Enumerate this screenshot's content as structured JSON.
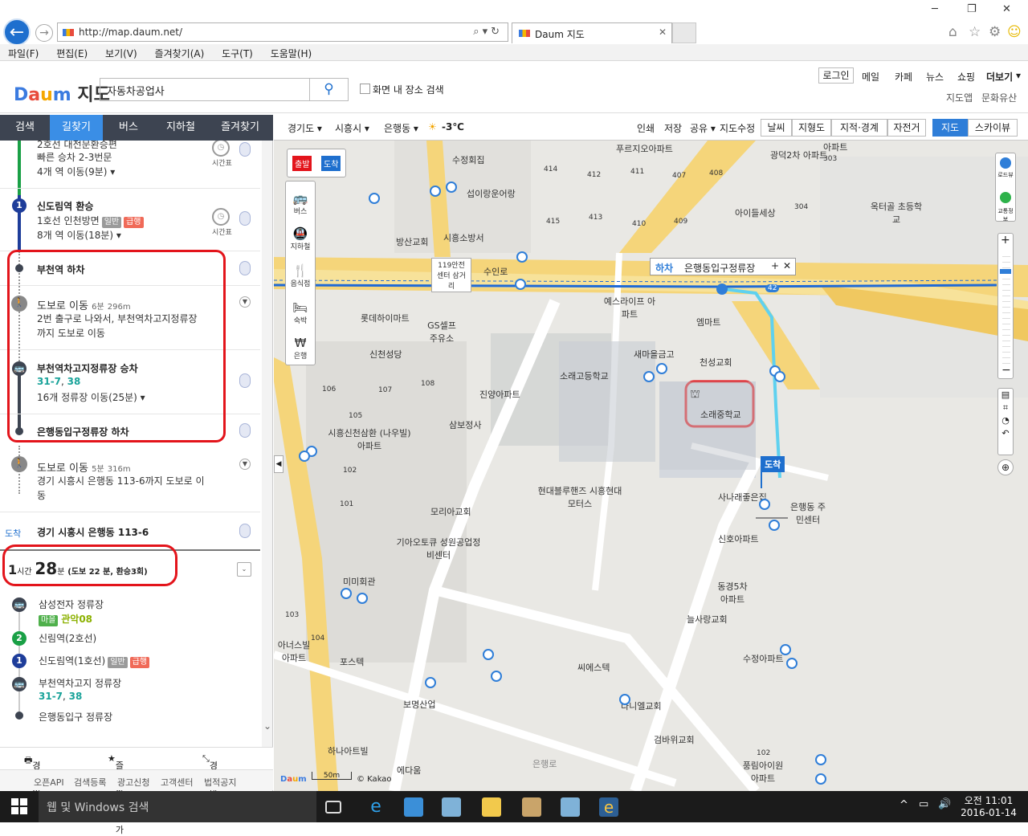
{
  "browser": {
    "url": "http://map.daum.net/",
    "tab_title": "Daum 지도",
    "menu": [
      "파일(F)",
      "편집(E)",
      "보기(V)",
      "즐겨찾기(A)",
      "도구(T)",
      "도움말(H)"
    ]
  },
  "header": {
    "logo": "Daum 지도",
    "logo_text": "지도",
    "search_value": "자동차공업사",
    "checkbox_label": "화면 내 장소 검색",
    "login": "로그인",
    "top_links": [
      "메일",
      "카페",
      "뉴스",
      "쇼핑",
      "더보기"
    ],
    "sub_links": [
      "지도앱",
      "문화유산"
    ]
  },
  "left_tabs": [
    "검색",
    "길찾기",
    "버스",
    "지하철",
    "즐겨찾기"
  ],
  "route": {
    "step0_sub1": "2호선 대전문환승편",
    "step0_sub2": "빠른 승차 2-3번문",
    "step0_sub3": "4개 역 이동(9분) ▾",
    "timetable": "시간표",
    "step1_title": "신도림역 환승",
    "step1_line": "1호선 인천방면",
    "tag_normal": "일반",
    "tag_express": "급행",
    "step1_move": "8개 역 이동(18분) ▾",
    "step2_title": "부천역 하차",
    "walk1_title": "도보로 이동",
    "walk1_time": "6분",
    "walk1_dist": "296m",
    "walk1_desc1": "2번 출구로 나와서, 부천역차고지정류장",
    "walk1_desc2": "까지 도보로 이동",
    "step3_title": "부천역차고지정류장 승차",
    "step3_bus1": "31-7",
    "step3_bus2": "38",
    "step3_move": "16개 정류장 이동(25분) ▾",
    "step4_title": "은행동입구정류장 하차",
    "walk2_title": "도보로 이동",
    "walk2_time": "5분",
    "walk2_dist": "316m",
    "walk2_desc1": "경기 시흥시 은행동 113-6까지 도보로 이",
    "walk2_desc2": "동",
    "arrive_tag": "도착",
    "arrive_addr": "경기 시흥시 은행동 113-6"
  },
  "summary": {
    "h": "1",
    "h_unit": "시간",
    "m": "28",
    "m_unit": "분",
    "detail": "(도보 22 분, 환승3회)"
  },
  "alt_route": {
    "s1": "삼성전자 정류장",
    "s1_tag": "마을",
    "s1_bus": "관악08",
    "s2": "신림역(2호선)",
    "s3": "신도림역(1호선)",
    "s4": "부천역차고지 정류장",
    "s4_bus1": "31-7",
    "s4_bus2": "38",
    "s5": "은행동입구 정류장"
  },
  "footer": {
    "print": "경로인쇄",
    "fav": "즐겨찾기 추가",
    "view": "경로 한눈에",
    "links": [
      "오픈API",
      "검색등록",
      "광고신청",
      "고객센터",
      "법적공지"
    ]
  },
  "map_toolbar": {
    "crumbs": [
      "경기도 ▾",
      "시흥시 ▾",
      "은행동 ▾"
    ],
    "weather": "-3℃",
    "actions": [
      "인쇄",
      "저장",
      "공유 ▾",
      "지도수정"
    ],
    "layers": [
      "날씨",
      "지형도",
      "지적·경계",
      "자전거"
    ],
    "views": [
      "지도",
      "스카이뷰"
    ]
  },
  "map_tools": {
    "start": "출발",
    "end": "도착",
    "items": [
      "버스",
      "지하철",
      "음식점",
      "숙박",
      "은행"
    ],
    "roadview": "로드뷰",
    "traffic": "교통정보"
  },
  "map_popup": {
    "tag": "하차",
    "name": "은행동입구정류장"
  },
  "map_labels": {
    "school": "소래중학교",
    "arrive": "도착",
    "scale": "50m",
    "kakao": "© Kakao",
    "l01": "푸르지오아파트",
    "l02": "광덕2차 아파트",
    "l03": "아파트",
    "l04": "수정회집",
    "l05": "섭이랑운어랑",
    "l06": "옥터골 초등학교",
    "l07": "아이들세상",
    "l08": "방산교회",
    "l09": "시흥소방서",
    "l10": "119안전센터 삼거리",
    "l11": "수인로",
    "l12": "예스라이프 아파트",
    "l13": "롯데하이마트",
    "l14": "GS셀프 주유소",
    "l15": "엠마트",
    "l16": "새마을금고",
    "l17": "천성교회",
    "l18": "신천성당",
    "l19": "소래고등학교",
    "l20": "진양아파트",
    "l21": "삼보정사",
    "l22": "시흥신천삼환 (나우빌)아파트",
    "l23": "현대블루핸즈 시흥현대모터스",
    "l24": "사나래좋은집",
    "l25": "은행동 주민센터",
    "l26": "모리아교회",
    "l27": "신호아파트",
    "l28": "기아오토큐 성원공업정비센터",
    "l29": "미미회관",
    "l30": "동경5차 아파트",
    "l31": "늘사랑교회",
    "l32": "아너스빌 아파트",
    "l33": "포스텍",
    "l34": "씨에스텍",
    "l35": "수정아파트",
    "l36": "보명산업",
    "l37": "다니엘교회",
    "l38": "검바위교회",
    "l39": "하나아트빌",
    "l40": "에다움",
    "l41": "풍림아이원 아파트",
    "l42": "은행로",
    "n414": "414",
    "n412": "412",
    "n411": "411",
    "n407": "407",
    "n408": "408",
    "n415": "415",
    "n413": "413",
    "n410": "410",
    "n409": "409",
    "n303": "303",
    "n304": "304",
    "n106": "106",
    "n107": "107",
    "n108": "108",
    "n105": "105",
    "n104": "104",
    "n103": "103",
    "n102": "102",
    "n101": "101",
    "n102b": "102",
    "n42": "42"
  },
  "taskbar": {
    "search": "웹 및 Windows 검색",
    "time": "오전 11:01",
    "date": "2016-01-14"
  }
}
